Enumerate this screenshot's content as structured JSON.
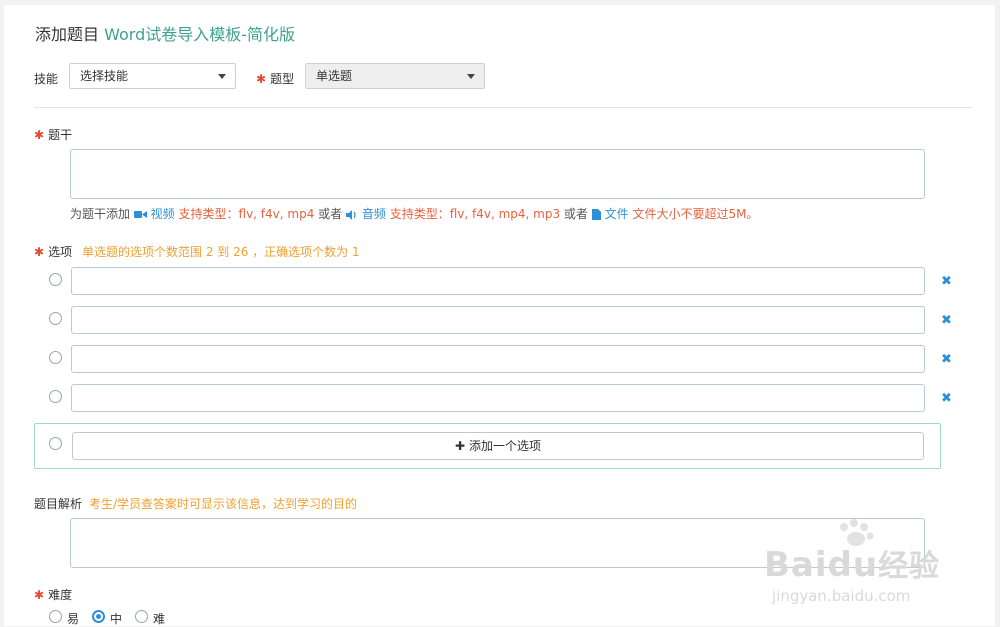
{
  "header": {
    "title_prefix": "添加题目",
    "title_link": "Word试卷导入模板-简化版"
  },
  "filters": {
    "skill_label": "技能",
    "skill_value": "选择技能",
    "type_label": "题型",
    "type_value": "单选题"
  },
  "stem": {
    "label": "题干",
    "hint_prefix": "为题干添加",
    "video_label": "视频",
    "video_types": "支持类型：flv, f4v, mp4",
    "or1": "或者",
    "audio_label": "音频",
    "audio_types": "支持类型：flv, f4v, mp4, mp3",
    "or2": "或者",
    "file_label": "文件",
    "file_limit": "文件大小不要超过5M。"
  },
  "options": {
    "label": "选项",
    "hint": "单选题的选项个数范围 2 到 26 ，正确选项个数为 1",
    "items": [
      "",
      "",
      "",
      ""
    ],
    "add_label": "添加一个选项"
  },
  "analysis": {
    "label": "题目解析",
    "hint": "考生/学员查答案时可显示该信息，达到学习的目的"
  },
  "difficulty": {
    "label": "难度",
    "choices": [
      {
        "label": "易",
        "selected": false
      },
      {
        "label": "中",
        "selected": true
      },
      {
        "label": "难",
        "selected": false
      }
    ]
  },
  "watermark": {
    "brand": "Bai",
    "brand2": "du",
    "cn": "经验",
    "url": "jingyan.baidu.com"
  },
  "colors": {
    "accent_green": "#3fa28e",
    "link_blue": "#2f8fd6",
    "required_red": "#e34b2e",
    "hint_orange": "#e8613c"
  }
}
